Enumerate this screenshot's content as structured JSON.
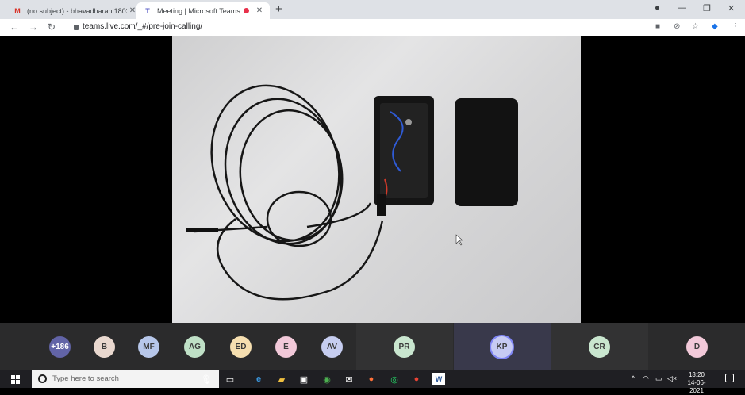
{
  "browser": {
    "tabs": [
      {
        "title": "(no subject) - bhavadharani1802",
        "icon": "gmail-icon",
        "active": false
      },
      {
        "title": "Meeting | Microsoft Teams",
        "icon": "teams-icon",
        "active": true,
        "recording": true
      }
    ],
    "url": "teams.live.com/_#/pre-join-calling/"
  },
  "participants": [
    {
      "initials": "+186",
      "color": "#6264a7",
      "text_color": "#ffffff"
    },
    {
      "initials": "B",
      "color": "#e9d8cf",
      "text_color": "#3b3b3b"
    },
    {
      "initials": "MF",
      "color": "#b7c7ea",
      "text_color": "#3b3b3b"
    },
    {
      "initials": "AG",
      "color": "#bfe0c6",
      "text_color": "#3b3b3b"
    },
    {
      "initials": "ED",
      "color": "#f6dfb0",
      "text_color": "#3b3b3b"
    },
    {
      "initials": "E",
      "color": "#f2c9d9",
      "text_color": "#3b3b3b"
    },
    {
      "initials": "AV",
      "color": "#c6cdf0",
      "text_color": "#3b3b3b"
    },
    {
      "initials": "PR",
      "color": "#c9e6cf",
      "text_color": "#3b3b3b"
    },
    {
      "initials": "KP",
      "color": "#c7cbf3",
      "text_color": "#3b3b3b",
      "active": true
    },
    {
      "initials": "CR",
      "color": "#c9e6cf",
      "text_color": "#3b3b3b"
    },
    {
      "initials": "D",
      "color": "#f2c9d9",
      "text_color": "#3b3b3b"
    }
  ],
  "taskbar": {
    "search_placeholder": "Type here to search",
    "time": "13:20",
    "date": "14-06-2021"
  }
}
